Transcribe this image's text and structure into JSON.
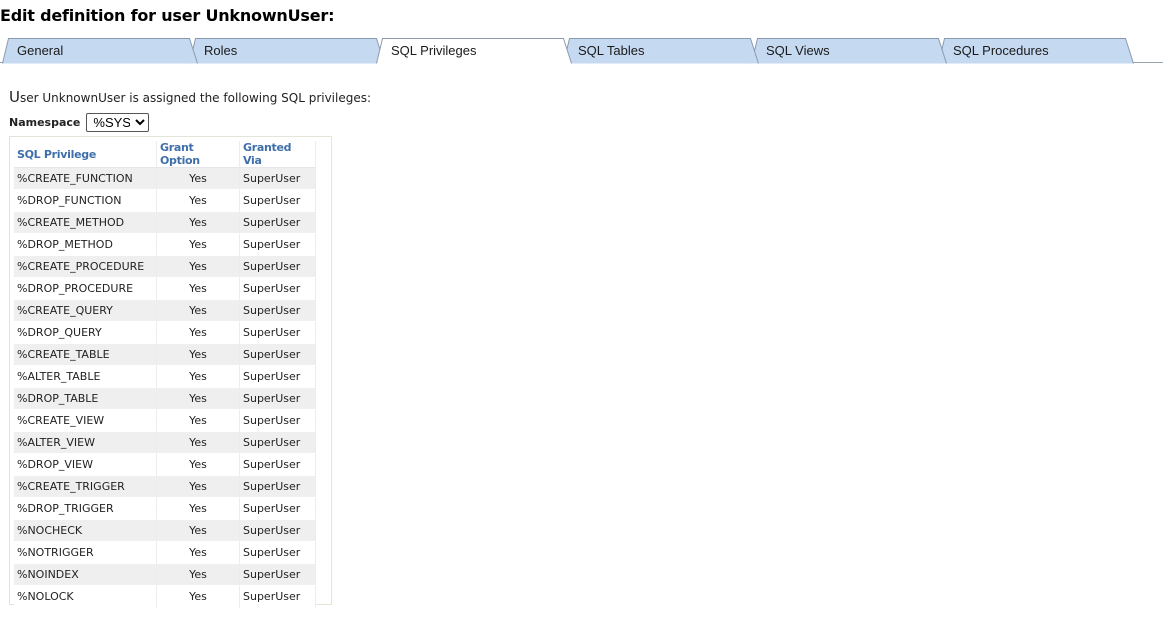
{
  "page": {
    "title": "Edit definition for user UnknownUser:"
  },
  "tabs": [
    {
      "label": "General",
      "active": false
    },
    {
      "label": "Roles",
      "active": false
    },
    {
      "label": "SQL Privileges",
      "active": true
    },
    {
      "label": "SQL Tables",
      "active": false
    },
    {
      "label": "SQL Views",
      "active": false
    },
    {
      "label": "SQL Procedures",
      "active": false
    }
  ],
  "intro": {
    "first_letter": "U",
    "rest": "ser UnknownUser is assigned the following SQL privileges:"
  },
  "namespace": {
    "label": "Namespace",
    "selected": "%SYS"
  },
  "table": {
    "headers": [
      "SQL Privilege",
      "Grant Option",
      "Granted Via"
    ],
    "rows": [
      [
        "%CREATE_FUNCTION",
        "Yes",
        "SuperUser"
      ],
      [
        "%DROP_FUNCTION",
        "Yes",
        "SuperUser"
      ],
      [
        "%CREATE_METHOD",
        "Yes",
        "SuperUser"
      ],
      [
        "%DROP_METHOD",
        "Yes",
        "SuperUser"
      ],
      [
        "%CREATE_PROCEDURE",
        "Yes",
        "SuperUser"
      ],
      [
        "%DROP_PROCEDURE",
        "Yes",
        "SuperUser"
      ],
      [
        "%CREATE_QUERY",
        "Yes",
        "SuperUser"
      ],
      [
        "%DROP_QUERY",
        "Yes",
        "SuperUser"
      ],
      [
        "%CREATE_TABLE",
        "Yes",
        "SuperUser"
      ],
      [
        "%ALTER_TABLE",
        "Yes",
        "SuperUser"
      ],
      [
        "%DROP_TABLE",
        "Yes",
        "SuperUser"
      ],
      [
        "%CREATE_VIEW",
        "Yes",
        "SuperUser"
      ],
      [
        "%ALTER_VIEW",
        "Yes",
        "SuperUser"
      ],
      [
        "%DROP_VIEW",
        "Yes",
        "SuperUser"
      ],
      [
        "%CREATE_TRIGGER",
        "Yes",
        "SuperUser"
      ],
      [
        "%DROP_TRIGGER",
        "Yes",
        "SuperUser"
      ],
      [
        "%NOCHECK",
        "Yes",
        "SuperUser"
      ],
      [
        "%NOTRIGGER",
        "Yes",
        "SuperUser"
      ],
      [
        "%NOINDEX",
        "Yes",
        "SuperUser"
      ],
      [
        "%NOLOCK",
        "Yes",
        "SuperUser"
      ]
    ]
  },
  "colors": {
    "tab_inactive": "#c5d9f1",
    "tab_active": "#ffffff",
    "tab_border": "#8a9bb0",
    "header_text": "#3f6fa8",
    "row_alt": "#efefef"
  }
}
